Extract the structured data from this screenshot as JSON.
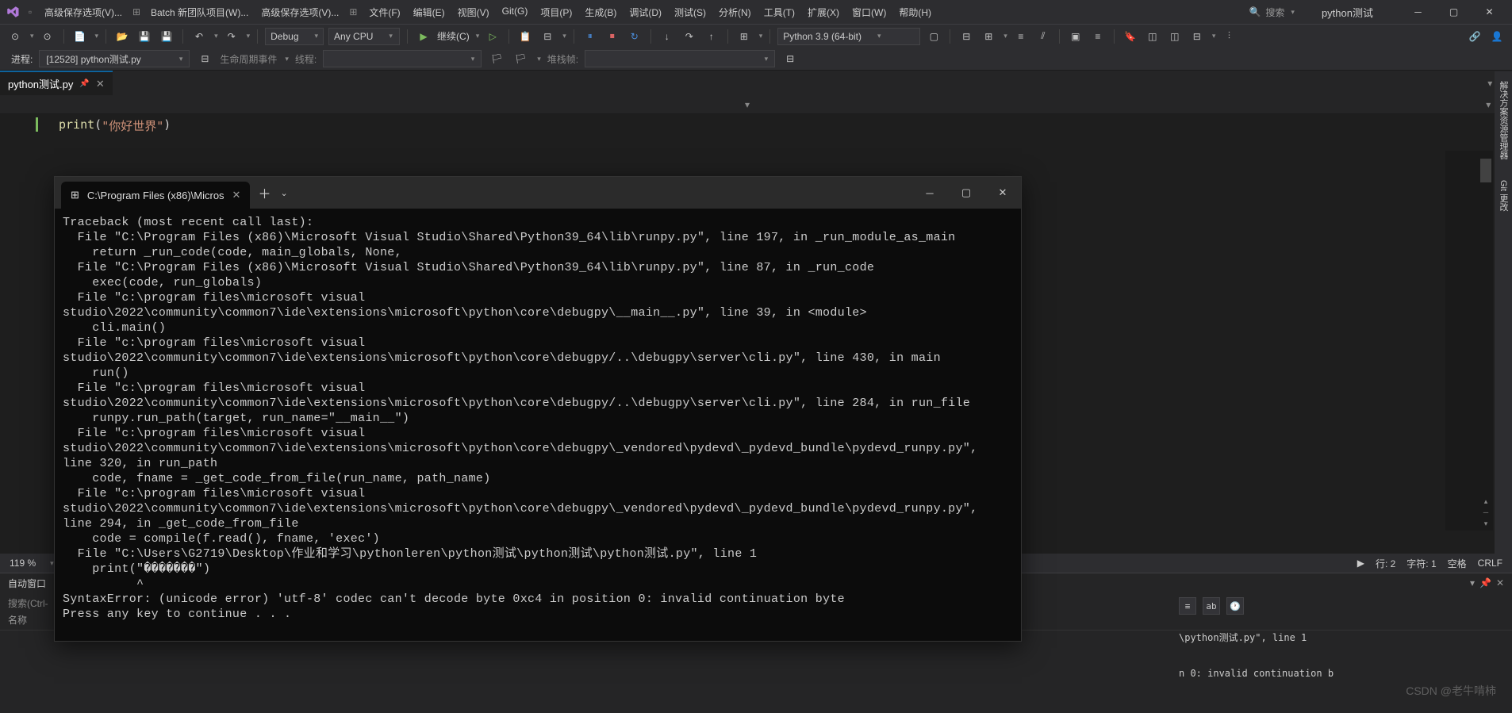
{
  "titlebar": {
    "items": [
      "高级保存选项(V)...",
      "Batch 新团队项目(W)...",
      "高级保存选项(V)..."
    ],
    "menu": [
      "文件(F)",
      "编辑(E)",
      "视图(V)",
      "Git(G)",
      "项目(P)",
      "生成(B)",
      "调试(D)",
      "测试(S)",
      "分析(N)",
      "工具(T)",
      "扩展(X)",
      "窗口(W)",
      "帮助(H)"
    ],
    "search": "搜索",
    "app": "python测试"
  },
  "toolbar": {
    "config": "Debug",
    "platform": "Any CPU",
    "continue": "继续(C)",
    "python": "Python 3.9 (64-bit)"
  },
  "toolbar2": {
    "process_label": "进程:",
    "process_value": "[12528] python测试.py",
    "lifecycle": "生命周期事件",
    "thread": "线程:",
    "stackframe": "堆栈帧:"
  },
  "tab": {
    "name": "python测试.py"
  },
  "editor": {
    "code_kw": "print",
    "code_str": "\"你好世界\""
  },
  "terminal": {
    "tab_title": "C:\\Program Files (x86)\\Micros",
    "output": "Traceback (most recent call last):\n  File \"C:\\Program Files (x86)\\Microsoft Visual Studio\\Shared\\Python39_64\\lib\\runpy.py\", line 197, in _run_module_as_main\n    return _run_code(code, main_globals, None,\n  File \"C:\\Program Files (x86)\\Microsoft Visual Studio\\Shared\\Python39_64\\lib\\runpy.py\", line 87, in _run_code\n    exec(code, run_globals)\n  File \"c:\\program files\\microsoft visual studio\\2022\\community\\common7\\ide\\extensions\\microsoft\\python\\core\\debugpy\\__main__.py\", line 39, in <module>\n    cli.main()\n  File \"c:\\program files\\microsoft visual studio\\2022\\community\\common7\\ide\\extensions\\microsoft\\python\\core\\debugpy/..\\debugpy\\server\\cli.py\", line 430, in main\n    run()\n  File \"c:\\program files\\microsoft visual studio\\2022\\community\\common7\\ide\\extensions\\microsoft\\python\\core\\debugpy/..\\debugpy\\server\\cli.py\", line 284, in run_file\n    runpy.run_path(target, run_name=\"__main__\")\n  File \"c:\\program files\\microsoft visual studio\\2022\\community\\common7\\ide\\extensions\\microsoft\\python\\core\\debugpy\\_vendored\\pydevd\\_pydevd_bundle\\pydevd_runpy.py\", line 320, in run_path\n    code, fname = _get_code_from_file(run_name, path_name)\n  File \"c:\\program files\\microsoft visual studio\\2022\\community\\common7\\ide\\extensions\\microsoft\\python\\core\\debugpy\\_vendored\\pydevd\\_pydevd_bundle\\pydevd_runpy.py\", line 294, in _get_code_from_file\n    code = compile(f.read(), fname, 'exec')\n  File \"C:\\Users\\G2719\\Desktop\\作业和学习\\pythonleren\\python测试\\python测试\\python测试.py\", line 1\n    print(\"�������\")\n          ^\nSyntaxError: (unicode error) 'utf-8' codec can't decode byte 0xc4 in position 0: invalid continuation byte\nPress any key to continue . . ."
  },
  "statusbar": {
    "zoom": "119 %",
    "line": "行: 2",
    "col": "字符: 1",
    "spaces": "空格",
    "crlf": "CRLF"
  },
  "panel": {
    "title": "自动窗口",
    "search": "搜索(Ctrl-",
    "col_name": "名称"
  },
  "output_right": {
    "line1": "\\python测试.py\", line 1",
    "line2": "n 0: invalid continuation b"
  },
  "sidebar": {
    "tab1": "解决方案资源管理器",
    "tab2": "Git 更改"
  },
  "watermark": "CSDN @老牛啃柿"
}
